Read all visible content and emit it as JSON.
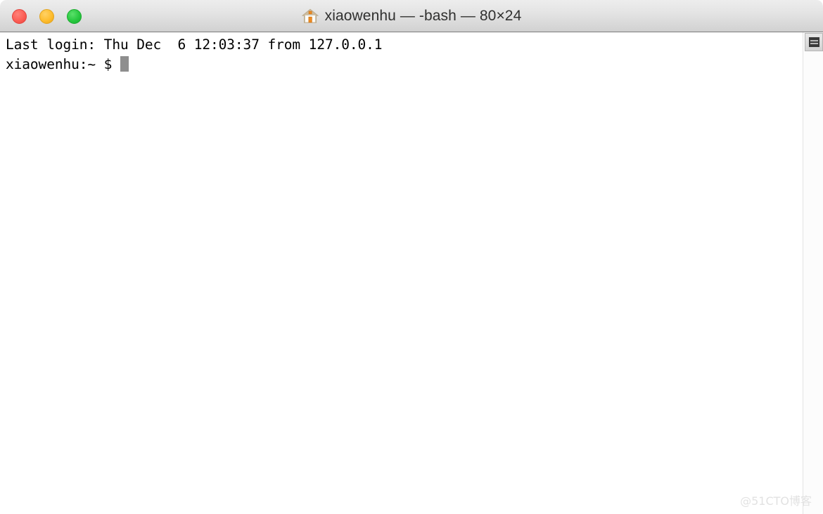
{
  "window": {
    "title": "xiaowenhu — -bash — 80×24",
    "home_icon": "home-icon",
    "traffic_lights": [
      {
        "name": "close",
        "label": "Close",
        "color": "#fc5e55"
      },
      {
        "name": "minimize",
        "label": "Minimize",
        "color": "#febd2e"
      },
      {
        "name": "zoom",
        "label": "Zoom",
        "color": "#28c840"
      }
    ]
  },
  "terminal": {
    "background_color": "#ffffff",
    "foreground_color": "#000000",
    "cursor_color": "#8e8e8e",
    "columns": 80,
    "rows": 24,
    "lines": [
      "Last login: Thu Dec  6 12:03:37 from 127.0.0.1",
      "xiaowenhu:~ $ "
    ],
    "last_login_line": "Last login: Thu Dec  6 12:03:37 from 127.0.0.1",
    "prompt_line": "xiaowenhu:~ $ ",
    "login_day": "Thu",
    "login_month": "Dec",
    "login_date": "6",
    "login_time": "12:03:37",
    "login_host": "127.0.0.1",
    "hostname": "xiaowenhu",
    "cwd": "~",
    "prompt_symbol": "$"
  },
  "scrollbar": {
    "thumb_icon": "scrollbar-thumb-lines-icon",
    "position": "top"
  },
  "watermark": {
    "text": "@51CTO博客",
    "color": "#e2e2e2"
  }
}
